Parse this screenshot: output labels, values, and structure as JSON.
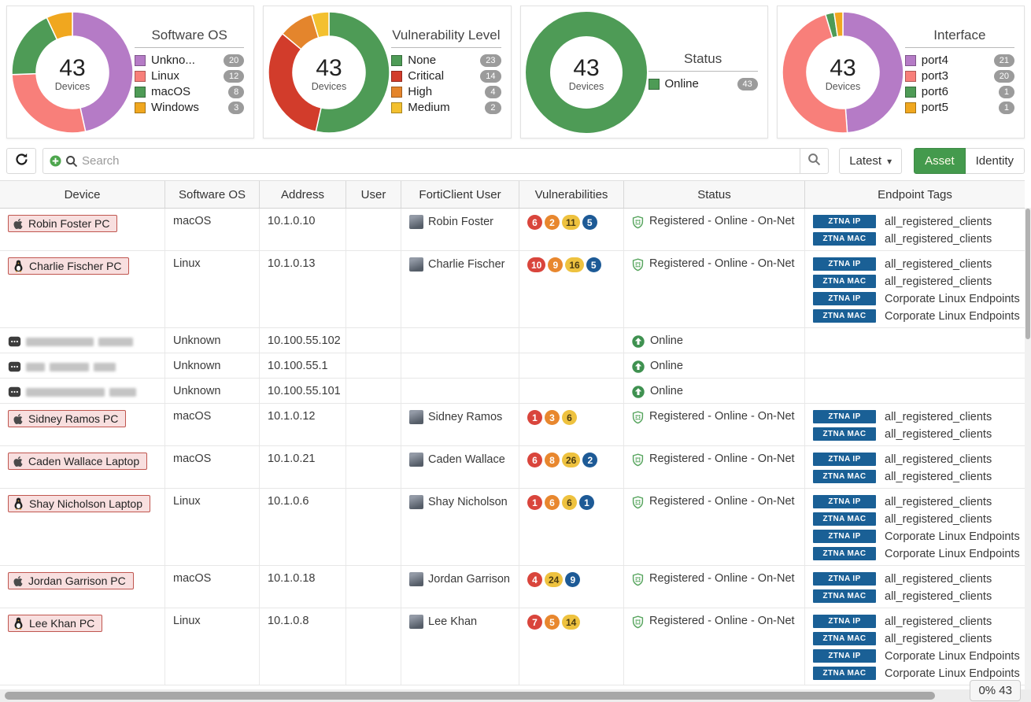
{
  "charts": [
    {
      "title": "Software OS",
      "center_value": "43",
      "center_label": "Devices",
      "items": [
        {
          "label": "Unkno...",
          "value": 20,
          "color": "#b57bc6"
        },
        {
          "label": "Linux",
          "value": 12,
          "color": "#f87f7a"
        },
        {
          "label": "macOS",
          "value": 8,
          "color": "#4e9b56"
        },
        {
          "label": "Windows",
          "value": 3,
          "color": "#f0a71f"
        }
      ]
    },
    {
      "title": "Vulnerability Level",
      "center_value": "43",
      "center_label": "Devices",
      "items": [
        {
          "label": "None",
          "value": 23,
          "color": "#4e9b56"
        },
        {
          "label": "Critical",
          "value": 14,
          "color": "#d23c2b"
        },
        {
          "label": "High",
          "value": 4,
          "color": "#e4852c"
        },
        {
          "label": "Medium",
          "value": 2,
          "color": "#f3c02f"
        }
      ]
    },
    {
      "title": "Status",
      "center_value": "43",
      "center_label": "Devices",
      "items": [
        {
          "label": "Online",
          "value": 43,
          "color": "#4e9b56"
        }
      ]
    },
    {
      "title": "Interface",
      "center_value": "43",
      "center_label": "Devices",
      "items": [
        {
          "label": "port4",
          "value": 21,
          "color": "#b57bc6"
        },
        {
          "label": "port3",
          "value": 20,
          "color": "#f87f7a"
        },
        {
          "label": "port6",
          "value": 1,
          "color": "#4e9b56"
        },
        {
          "label": "port5",
          "value": 1,
          "color": "#f0a71f"
        }
      ]
    }
  ],
  "toolbar": {
    "search_placeholder": "Search",
    "latest_label": "Latest",
    "asset_label": "Asset",
    "identity_label": "Identity"
  },
  "table": {
    "columns": [
      "Device",
      "Software OS",
      "Address",
      "User",
      "FortiClient User",
      "Vulnerabilities",
      "Status",
      "Endpoint Tags"
    ],
    "rows": [
      {
        "device": {
          "name": "Robin Foster PC",
          "icon": "apple-icon",
          "chip": true
        },
        "software_os": "macOS",
        "address": "10.1.0.10",
        "user": "",
        "forticlient_user": "Robin Foster",
        "vulnerabilities": [
          {
            "severity": "critical",
            "count": 6
          },
          {
            "severity": "high",
            "count": 2
          },
          {
            "severity": "medium",
            "count": 11
          },
          {
            "severity": "low",
            "count": 5
          }
        ],
        "status": {
          "label": "Registered - Online - On-Net",
          "icon": "shield-icon"
        },
        "tags": [
          {
            "badge": "ZTNA IP",
            "name": "all_registered_clients"
          },
          {
            "badge": "ZTNA MAC",
            "name": "all_registered_clients"
          }
        ]
      },
      {
        "device": {
          "name": "Charlie Fischer PC",
          "icon": "linux-icon",
          "chip": true
        },
        "software_os": "Linux",
        "address": "10.1.0.13",
        "user": "",
        "forticlient_user": "Charlie Fischer",
        "vulnerabilities": [
          {
            "severity": "critical",
            "count": 10
          },
          {
            "severity": "high",
            "count": 9
          },
          {
            "severity": "medium",
            "count": 16
          },
          {
            "severity": "low",
            "count": 5
          }
        ],
        "status": {
          "label": "Registered - Online - On-Net",
          "icon": "shield-icon"
        },
        "tags": [
          {
            "badge": "ZTNA IP",
            "name": "all_registered_clients"
          },
          {
            "badge": "ZTNA MAC",
            "name": "all_registered_clients"
          },
          {
            "badge": "ZTNA IP",
            "name": "Corporate Linux Endpoints"
          },
          {
            "badge": "ZTNA MAC",
            "name": "Corporate Linux Endpoints"
          }
        ]
      },
      {
        "device": {
          "redacted": true,
          "icon": "unknown-device-icon",
          "masked_widths": [
            86,
            44
          ]
        },
        "software_os": "Unknown",
        "address": "10.100.55.102",
        "user": "",
        "forticlient_user": "",
        "vulnerabilities": [],
        "status": {
          "label": "Online",
          "icon": "online-icon"
        },
        "tags": []
      },
      {
        "device": {
          "redacted": true,
          "icon": "unknown-device-icon",
          "masked_widths": [
            24,
            50,
            28
          ]
        },
        "software_os": "Unknown",
        "address": "10.100.55.1",
        "user": "",
        "forticlient_user": "",
        "vulnerabilities": [],
        "status": {
          "label": "Online",
          "icon": "online-icon"
        },
        "tags": []
      },
      {
        "device": {
          "redacted": true,
          "icon": "unknown-device-icon",
          "masked_widths": [
            100,
            34
          ]
        },
        "software_os": "Unknown",
        "address": "10.100.55.101",
        "user": "",
        "forticlient_user": "",
        "vulnerabilities": [],
        "status": {
          "label": "Online",
          "icon": "online-icon"
        },
        "tags": []
      },
      {
        "device": {
          "name": "Sidney Ramos PC",
          "icon": "apple-icon",
          "chip": true
        },
        "software_os": "macOS",
        "address": "10.1.0.12",
        "user": "",
        "forticlient_user": "Sidney Ramos",
        "vulnerabilities": [
          {
            "severity": "critical",
            "count": 1
          },
          {
            "severity": "high",
            "count": 3
          },
          {
            "severity": "medium",
            "count": 6
          }
        ],
        "status": {
          "label": "Registered - Online - On-Net",
          "icon": "shield-icon"
        },
        "tags": [
          {
            "badge": "ZTNA IP",
            "name": "all_registered_clients"
          },
          {
            "badge": "ZTNA MAC",
            "name": "all_registered_clients"
          }
        ]
      },
      {
        "device": {
          "name": "Caden Wallace Laptop",
          "icon": "apple-icon",
          "chip": true
        },
        "software_os": "macOS",
        "address": "10.1.0.21",
        "user": "",
        "forticlient_user": "Caden Wallace",
        "vulnerabilities": [
          {
            "severity": "critical",
            "count": 6
          },
          {
            "severity": "high",
            "count": 8
          },
          {
            "severity": "medium",
            "count": 26
          },
          {
            "severity": "low",
            "count": 2
          }
        ],
        "status": {
          "label": "Registered - Online - On-Net",
          "icon": "shield-icon"
        },
        "tags": [
          {
            "badge": "ZTNA IP",
            "name": "all_registered_clients"
          },
          {
            "badge": "ZTNA MAC",
            "name": "all_registered_clients"
          }
        ]
      },
      {
        "device": {
          "name": "Shay Nicholson Laptop",
          "icon": "linux-icon",
          "chip": true
        },
        "software_os": "Linux",
        "address": "10.1.0.6",
        "user": "",
        "forticlient_user": "Shay Nicholson",
        "vulnerabilities": [
          {
            "severity": "critical",
            "count": 1
          },
          {
            "severity": "high",
            "count": 6
          },
          {
            "severity": "medium",
            "count": 6
          },
          {
            "severity": "low",
            "count": 1
          }
        ],
        "status": {
          "label": "Registered - Online - On-Net",
          "icon": "shield-icon"
        },
        "tags": [
          {
            "badge": "ZTNA IP",
            "name": "all_registered_clients"
          },
          {
            "badge": "ZTNA MAC",
            "name": "all_registered_clients"
          },
          {
            "badge": "ZTNA IP",
            "name": "Corporate Linux Endpoints"
          },
          {
            "badge": "ZTNA MAC",
            "name": "Corporate Linux Endpoints"
          }
        ]
      },
      {
        "device": {
          "name": "Jordan Garrison PC",
          "icon": "apple-icon",
          "chip": true
        },
        "software_os": "macOS",
        "address": "10.1.0.18",
        "user": "",
        "forticlient_user": "Jordan Garrison",
        "vulnerabilities": [
          {
            "severity": "critical",
            "count": 4
          },
          {
            "severity": "medium",
            "count": 24
          },
          {
            "severity": "low",
            "count": 9
          }
        ],
        "status": {
          "label": "Registered - Online - On-Net",
          "icon": "shield-icon"
        },
        "tags": [
          {
            "badge": "ZTNA IP",
            "name": "all_registered_clients"
          },
          {
            "badge": "ZTNA MAC",
            "name": "all_registered_clients"
          }
        ]
      },
      {
        "device": {
          "name": "Lee Khan PC",
          "icon": "linux-icon",
          "chip": true
        },
        "software_os": "Linux",
        "address": "10.1.0.8",
        "user": "",
        "forticlient_user": "Lee Khan",
        "vulnerabilities": [
          {
            "severity": "critical",
            "count": 7
          },
          {
            "severity": "high",
            "count": 5
          },
          {
            "severity": "medium",
            "count": 14
          }
        ],
        "status": {
          "label": "Registered - Online - On-Net",
          "icon": "shield-icon"
        },
        "tags": [
          {
            "badge": "ZTNA IP",
            "name": "all_registered_clients"
          },
          {
            "badge": "ZTNA MAC",
            "name": "all_registered_clients"
          },
          {
            "badge": "ZTNA IP",
            "name": "Corporate Linux Endpoints"
          },
          {
            "badge": "ZTNA MAC",
            "name": "Corporate Linux Endpoints"
          }
        ]
      }
    ]
  },
  "footer": {
    "progress_badge": "0% 43"
  }
}
